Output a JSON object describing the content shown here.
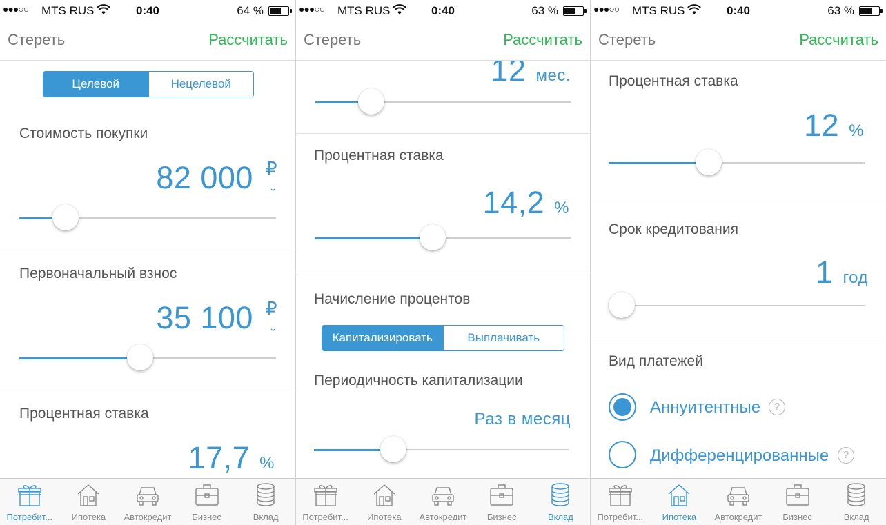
{
  "colors": {
    "accent": "#3b97d3",
    "action_green": "#2dbb53",
    "inactive_tab": "#8a8a8a"
  },
  "tab_labels": [
    "Потребит...",
    "Ипотека",
    "Автокредит",
    "Бизнес",
    "Вклад"
  ],
  "tab_icons": [
    "gift-icon",
    "house-icon",
    "car-icon",
    "briefcase-icon",
    "coins-stack-icon"
  ],
  "screen1": {
    "status": {
      "signal": "●●●○○",
      "carrier": "MTS RUS",
      "time": "0:40",
      "battery": "64 %",
      "battery_level": 0.64
    },
    "nav": {
      "left": "Стереть",
      "right": "Рассчитать"
    },
    "segmented": {
      "options": [
        "Целевой",
        "Нецелевой"
      ],
      "selected": 0
    },
    "purchase": {
      "label": "Стоимость покупки",
      "value": "82 000",
      "unit": "₽",
      "slider": 0.18
    },
    "down_payment": {
      "label": "Первоначальный взнос",
      "value": "35 100",
      "unit": "₽",
      "slider": 0.47
    },
    "rate": {
      "label": "Процентная ставка",
      "value": "17,7",
      "unit": "%"
    },
    "active_tab": 0
  },
  "screen2": {
    "status": {
      "signal": "●●●○○",
      "carrier": "MTS RUS",
      "time": "0:40",
      "battery": "63 %",
      "battery_level": 0.63
    },
    "nav": {
      "left": "Стереть",
      "right": "Рассчитать"
    },
    "term": {
      "value": "12",
      "unit": "мес.",
      "slider": 0.22
    },
    "rate": {
      "label": "Процентная ставка",
      "value": "14,2",
      "unit": "%",
      "slider": 0.46
    },
    "interest": {
      "label": "Начисление процентов",
      "options": [
        "Капитализировать",
        "Выплачивать"
      ],
      "selected": 0
    },
    "periodicity": {
      "label": "Периодичность капитализации",
      "value": "Раз в месяц",
      "slider": 0.31
    },
    "active_tab": 4
  },
  "screen3": {
    "status": {
      "signal": "●●●○○",
      "carrier": "MTS RUS",
      "time": "0:40",
      "battery": "63 %",
      "battery_level": 0.63
    },
    "nav": {
      "left": "Стереть",
      "right": "Рассчитать"
    },
    "rate": {
      "label": "Процентная ставка",
      "value": "12",
      "unit": "%",
      "slider": 0.39
    },
    "term": {
      "label": "Срок кредитования",
      "value": "1",
      "unit": "год",
      "slider": 0.05
    },
    "payment_type": {
      "label": "Вид платежей",
      "options": [
        "Аннуитентные",
        "Дифференцированные"
      ],
      "selected": 0,
      "help": "?"
    },
    "active_tab": 1
  }
}
